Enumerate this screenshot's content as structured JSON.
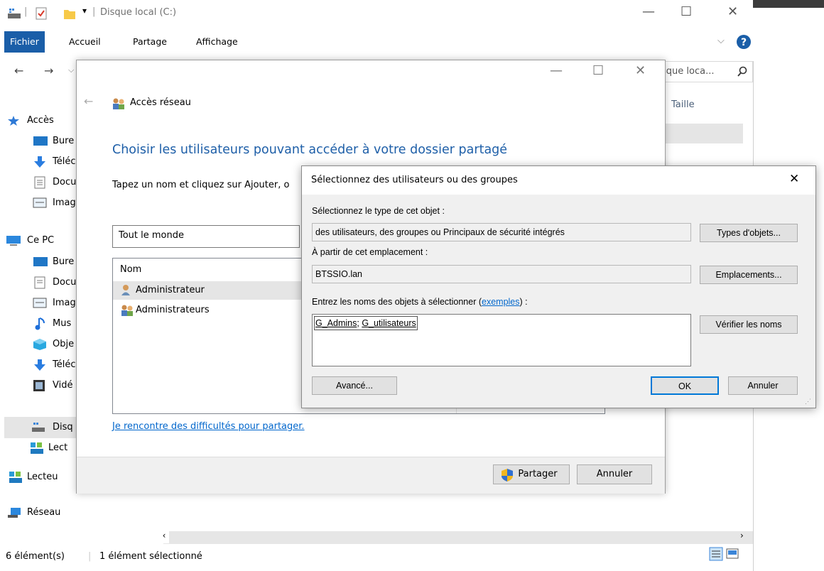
{
  "explorer": {
    "title": "Disque local (C:)",
    "ribbon_tabs": [
      "Fichier",
      "Accueil",
      "Partage",
      "Affichage"
    ],
    "search_placeholder": "sque loca...",
    "column_size": "Taille",
    "nav": [
      {
        "label": "Accès",
        "icon": "star-icon"
      },
      {
        "label": "Bure",
        "icon": "desktop-icon"
      },
      {
        "label": "Téléc",
        "icon": "download-icon"
      },
      {
        "label": "Docu",
        "icon": "document-icon"
      },
      {
        "label": "Imag",
        "icon": "image-icon"
      },
      {
        "label": "Ce PC",
        "icon": "pc-icon"
      },
      {
        "label": "Bure",
        "icon": "desktop-icon"
      },
      {
        "label": "Docu",
        "icon": "document-icon"
      },
      {
        "label": "Imag",
        "icon": "image-icon"
      },
      {
        "label": "Mus",
        "icon": "music-icon"
      },
      {
        "label": "Obje",
        "icon": "3d-object-icon"
      },
      {
        "label": "Téléc",
        "icon": "download-icon"
      },
      {
        "label": "Vidé",
        "icon": "video-icon"
      },
      {
        "label": "Disq",
        "icon": "drive-icon"
      },
      {
        "label": "Lect",
        "icon": "network-drive-icon"
      },
      {
        "label": "Lecteu",
        "icon": "network-drive-icon"
      },
      {
        "label": "Réseau",
        "icon": "network-icon"
      }
    ],
    "status_count": "6 élément(s)",
    "status_selected": "1 élément sélectionné"
  },
  "wizard": {
    "title": "Accès réseau",
    "heading": "Choisir les utilisateurs pouvant accéder à votre dossier partagé",
    "instruction": "Tapez un nom et cliquez sur Ajouter, o",
    "name_input_value": "Tout le monde",
    "list_header": "Nom",
    "list_items": [
      "Administrateur",
      "Administrateurs"
    ],
    "help_link": "Je rencontre des difficultés pour partager.",
    "share_button": "Partager",
    "cancel_button": "Annuler"
  },
  "select_dialog": {
    "title": "Sélectionnez des utilisateurs ou des groupes",
    "object_type_label": "Sélectionnez le type de cet objet :",
    "object_type_value": "des utilisateurs, des groupes ou Principaux de sécurité intégrés",
    "object_types_button": "Types d'objets...",
    "location_label": "À partir de cet emplacement :",
    "location_value": "BTSSIO.lan",
    "locations_button": "Emplacements...",
    "names_label": "Entrez les noms des objets à sélectionner (",
    "names_label_link": "exemples",
    "names_label_end": ") :",
    "names_value_1": "G_Admins",
    "names_value_sep": "; ",
    "names_value_2": "G_utilisateurs",
    "check_names_button": "Vérifier les noms",
    "advanced_button": "Avancé...",
    "ok_button": "OK",
    "cancel_button": "Annuler"
  },
  "colors": {
    "accent": "#1a5ea8",
    "link": "#0066cc",
    "heading": "#1e5fa8",
    "selection": "#e5e5e5"
  }
}
